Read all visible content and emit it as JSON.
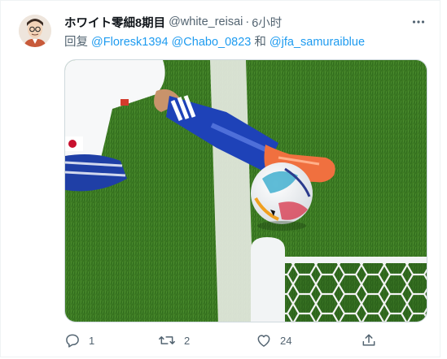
{
  "tweet": {
    "display_name": "ホワイト零細8期目",
    "handle": "@white_reisai",
    "separator": "·",
    "time": "6小时",
    "reply_prefix": "回复",
    "mentions": [
      "@Floresk1394",
      "@Chabo_0823"
    ],
    "conjunction": "和",
    "last_mention": "@jfa_samuraiblue"
  },
  "actions": {
    "reply_count": "1",
    "retweet_count": "2",
    "like_count": "24"
  },
  "icons": [
    "more-icon",
    "reply-icon",
    "retweet-icon",
    "like-icon",
    "share-icon"
  ],
  "colors": {
    "link": "#1d9bf0",
    "muted": "#536471"
  }
}
